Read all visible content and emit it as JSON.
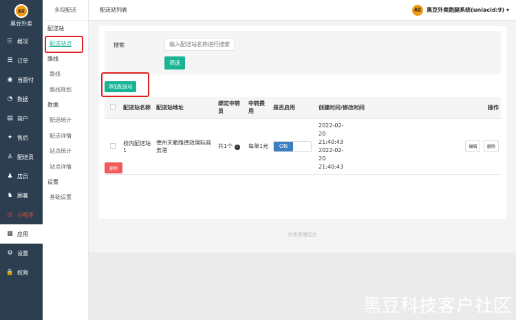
{
  "brand": {
    "name": "黑豆外卖",
    "logo_text": "黑豆"
  },
  "sidebar": {
    "items": [
      {
        "icon": "⎘",
        "label": "概况",
        "name": "overview"
      },
      {
        "icon": "☰",
        "label": "订单",
        "name": "orders"
      },
      {
        "icon": "◉",
        "label": "当面付",
        "name": "face-pay"
      },
      {
        "icon": "◔",
        "label": "数据",
        "name": "data"
      },
      {
        "icon": "▤",
        "label": "商户",
        "name": "merchants"
      },
      {
        "icon": "✦",
        "label": "售后",
        "name": "after-sales"
      },
      {
        "icon": "♙",
        "label": "配送员",
        "name": "couriers"
      },
      {
        "icon": "♟",
        "label": "店员",
        "name": "staff"
      },
      {
        "icon": "♞",
        "label": "顾客",
        "name": "customers"
      },
      {
        "icon": "◎",
        "label": "小程序",
        "name": "miniapp"
      },
      {
        "icon": "▦",
        "label": "应用",
        "name": "apps"
      },
      {
        "icon": "⚙",
        "label": "设置",
        "name": "settings"
      },
      {
        "icon": "🔒",
        "label": "权限",
        "name": "permissions"
      }
    ]
  },
  "subnav": {
    "title": "多段配送",
    "group_station": "配送站",
    "station_points": "配送站点",
    "group_route": "路线",
    "route": "路线",
    "route_plan": "路线规划",
    "group_data": "数据",
    "delivery_stats": "配送统计",
    "delivery_detail": "配送详情",
    "station_stats": "站点统计",
    "station_detail": "站点详情",
    "group_settings": "设置",
    "basic_settings": "基础设置"
  },
  "topbar": {
    "title": "配送站列表",
    "user": "黑豆外卖跑腿系统(uniacid:9)",
    "caret": "▾"
  },
  "search": {
    "label": "搜索",
    "placeholder": "输入配送站名称进行搜索",
    "filter_label": "筛选"
  },
  "add_button": "添加配送站",
  "table": {
    "headers": {
      "name": "配送站名称",
      "address": "配送站地址",
      "bound": "绑定中转员",
      "fee": "中转费用",
      "enabled": "是否启用",
      "time": "创建时间/修改时间",
      "ops": "操作"
    },
    "rows": [
      {
        "name": "校内配送站1",
        "address": "德州天衢路德政国际商务港",
        "bound": "共1个",
        "fee": "每单1元",
        "toggle": "ON",
        "created": "2022-02-20 21:40:43",
        "modified": "2022-02-20 21:40:43",
        "edit": "编辑",
        "delete": "删除"
      }
    ]
  },
  "delete_button": "删除",
  "footer": "外卖管理后台",
  "watermark": "黑豆科技客户社区",
  "colors": {
    "sidebar": "#2c3e50",
    "accent": "#1ab394",
    "danger": "#f05a5a",
    "toggle_on": "#3b7fc4",
    "highlight": "#e02020"
  }
}
